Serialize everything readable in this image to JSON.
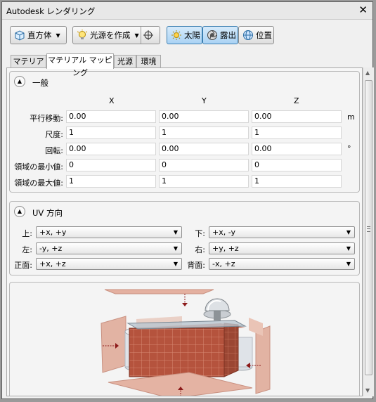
{
  "window": {
    "title": "Autodesk レンダリング",
    "close": "✕"
  },
  "toolbar": {
    "box": "直方体",
    "create_light": "光源を作成",
    "sun": "太陽",
    "exposure": "露出",
    "location": "位置"
  },
  "tabs": [
    "マテリアル",
    "マテリアル マッピング",
    "光源",
    "環境"
  ],
  "general": {
    "title": "一般",
    "columns": [
      "X",
      "Y",
      "Z"
    ],
    "rows": [
      {
        "label": "平行移動:",
        "values": [
          "0.00",
          "0.00",
          "0.00"
        ],
        "unit": "m"
      },
      {
        "label": "尺度:",
        "values": [
          "1",
          "1",
          "1"
        ],
        "unit": ""
      },
      {
        "label": "回転:",
        "values": [
          "0.00",
          "0.00",
          "0.00"
        ],
        "unit": "°"
      },
      {
        "label": "領域の最小値:",
        "values": [
          "0",
          "0",
          "0"
        ],
        "unit": ""
      },
      {
        "label": "領域の最大値:",
        "values": [
          "1",
          "1",
          "1"
        ],
        "unit": ""
      }
    ]
  },
  "uv": {
    "title": "UV 方向",
    "top": {
      "label": "上:",
      "value": "+x, +y"
    },
    "bottom": {
      "label": "下:",
      "value": "+x, -y"
    },
    "left": {
      "label": "左:",
      "value": "-y, +z"
    },
    "right": {
      "label": "右:",
      "value": "+y, +z"
    },
    "front": {
      "label": "正面:",
      "value": "+x, +z"
    },
    "back": {
      "label": "背面:",
      "value": "-x, +z"
    }
  }
}
